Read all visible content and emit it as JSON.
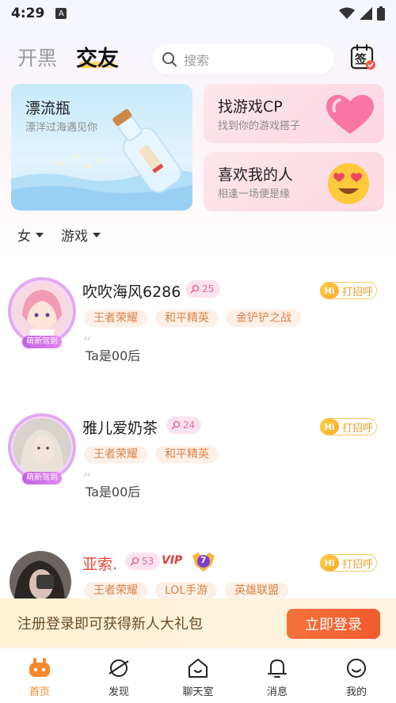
{
  "status": {
    "time": "4:29",
    "notif_letter": "A"
  },
  "header": {
    "tab_kaihei": "开黑",
    "tab_jiaoyou": "交友",
    "search_placeholder": "搜索",
    "checkin_label": "签"
  },
  "cards": {
    "bottle": {
      "title": "漂流瓶",
      "subtitle": "漂洋过海遇见你"
    },
    "cp": {
      "title": "找游戏CP",
      "subtitle": "找到你的游戏搭子"
    },
    "like": {
      "title": "喜欢我的人",
      "subtitle": "相逢一场便是缘"
    }
  },
  "filters": [
    {
      "label": "女"
    },
    {
      "label": "游戏"
    }
  ],
  "users": [
    {
      "name": "吹吹海风6286",
      "level": "25",
      "frame_badge": "萌新驾到",
      "tags": [
        "王者荣耀",
        "和平精英",
        "金铲铲之战"
      ],
      "bio": "Ta是00后",
      "hi_label": "Hi",
      "greet": "打招呼"
    },
    {
      "name": "雅儿爱奶茶",
      "level": "24",
      "frame_badge": "萌新驾到",
      "tags": [
        "王者荣耀",
        "和平精英"
      ],
      "bio": "Ta是00后",
      "hi_label": "Hi",
      "greet": "打招呼"
    },
    {
      "name": "亚索.",
      "level": "53",
      "vip": "VIP",
      "rank": "7",
      "tags": [
        "王者荣耀",
        "LOL手游",
        "英雄联盟"
      ],
      "hi_label": "Hi",
      "greet": "打招呼"
    }
  ],
  "banner": {
    "text": "注册登录即可获得新人大礼包",
    "button": "立即登录"
  },
  "nav": [
    {
      "label": "首页",
      "icon": "gamepad-icon",
      "active": true
    },
    {
      "label": "发现",
      "icon": "planet-icon",
      "active": false
    },
    {
      "label": "聊天室",
      "icon": "house-icon",
      "active": false
    },
    {
      "label": "消息",
      "icon": "bell-icon",
      "active": false
    },
    {
      "label": "我的",
      "icon": "smile-icon",
      "active": false
    }
  ],
  "colors": {
    "accent": "#f4882a",
    "brand_pink": "#e76aa0",
    "login_orange": "#f15a2f"
  }
}
